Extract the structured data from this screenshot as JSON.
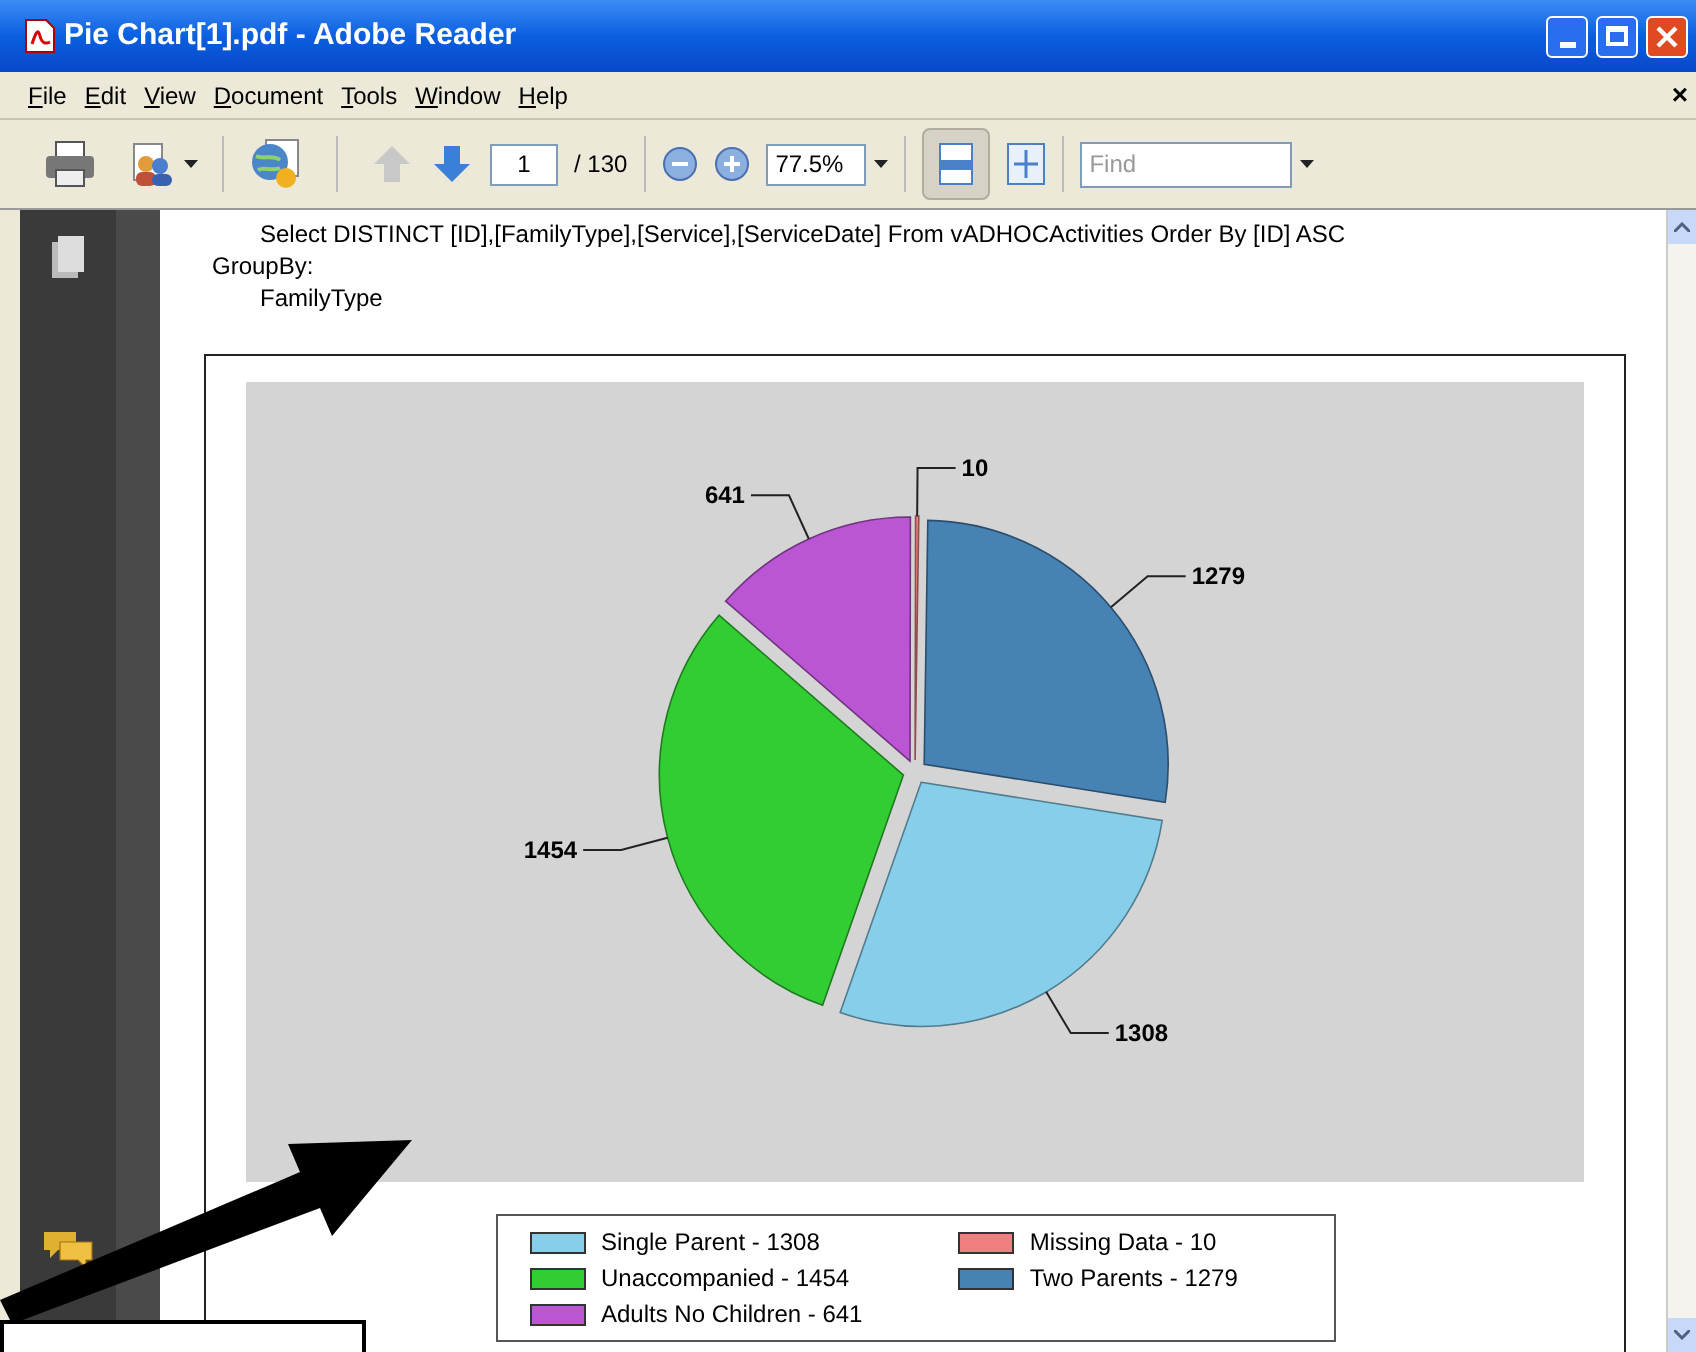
{
  "window": {
    "title": "Pie Chart[1].pdf - Adobe Reader"
  },
  "menu": [
    "File",
    "Edit",
    "View",
    "Document",
    "Tools",
    "Window",
    "Help"
  ],
  "menu_close": "×",
  "toolbar": {
    "previous_page_disabled": true,
    "page": "1",
    "page_count": "/ 130",
    "zoom": "77.5%",
    "fit_width_selected": true,
    "find_placeholder": "Find"
  },
  "document": {
    "query": "Select  DISTINCT [ID],[FamilyType],[Service],[ServiceDate] From vADHOCActivities  Order By [ID] ASC",
    "group_by_label": "GroupBy:",
    "group_by_field": "FamilyType"
  },
  "chart": {
    "chart_data": {
      "type": "pie",
      "values": [
        1308,
        1454,
        641,
        10,
        1279
      ],
      "data_labels": true
    },
    "legend": [
      {
        "label": "Single Parent - 1308",
        "color": "#87ceeb"
      },
      {
        "label": "Unaccompanied - 1454",
        "color": "#32cd32"
      },
      {
        "label": "Adults No Children - 641",
        "color": "#ba55d3"
      },
      {
        "label": "Missing Data - 10",
        "color": "#f08080"
      },
      {
        "label": "Two Parents - 1279",
        "color": "#4682b4"
      }
    ]
  }
}
